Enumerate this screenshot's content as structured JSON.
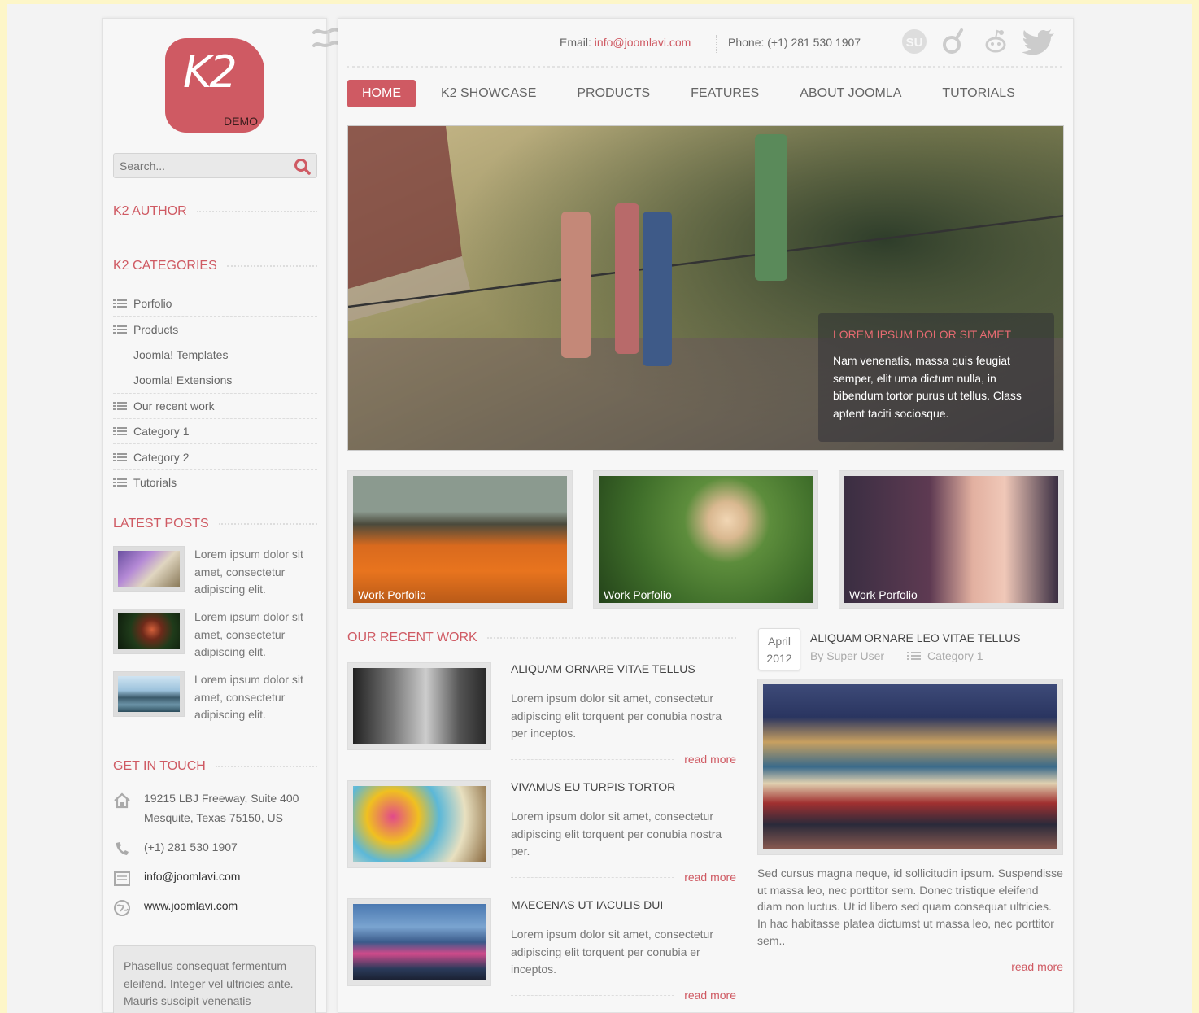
{
  "logo": {
    "mark": "K2",
    "sub": "DEMO"
  },
  "search": {
    "placeholder": "Search..."
  },
  "sidebar": {
    "author_title": "K2 AUTHOR",
    "categories_title": "K2 CATEGORIES",
    "categories": [
      {
        "label": "Porfolio"
      },
      {
        "label": "Products"
      },
      {
        "label": "Joomla! Templates"
      },
      {
        "label": "Joomla! Extensions"
      },
      {
        "label": "Our recent work"
      },
      {
        "label": "Category 1"
      },
      {
        "label": "Category 2"
      },
      {
        "label": "Tutorials"
      }
    ],
    "latest_title": "LATEST POSTS",
    "posts": [
      {
        "text": "Lorem ipsum dolor sit amet, consectetur adipiscing elit."
      },
      {
        "text": "Lorem ipsum dolor sit amet, consectetur adipiscing elit."
      },
      {
        "text": "Lorem ipsum dolor sit amet, consectetur adipiscing elit."
      }
    ],
    "touch_title": "GET IN TOUCH",
    "contact": {
      "address": "19215 LBJ Freeway, Suite 400 Mesquite, Texas 75150, US",
      "phone": "(+1) 281 530 1907",
      "email": "info@joomlavi.com",
      "web": "www.joomlavi.com"
    },
    "box_text": "Phasellus consequat fermentum eleifend. Integer vel ultricies ante. Mauris suscipit venenatis"
  },
  "topbar": {
    "email_label": "Email:",
    "email": "info@joomlavi.com",
    "phone": "Phone: (+1) 281 530 1907",
    "social": [
      "stumbleupon-icon",
      "delicious-icon",
      "reddit-icon",
      "twitter-icon"
    ]
  },
  "nav": [
    "HOME",
    "K2 SHOWCASE",
    "PRODUCTS",
    "FEATURES",
    "ABOUT JOOMLA",
    "TUTORIALS"
  ],
  "hero": {
    "title": "LOREM IPSUM DOLOR SIT AMET",
    "body": "Nam venenatis, massa quis feugiat semper, elit urna dictum nulla, in bibendum tortor purus ut tellus. Class aptent taciti sociosque."
  },
  "tiles": [
    {
      "label": "Work Porfolio"
    },
    {
      "label": "Work Porfolio"
    },
    {
      "label": "Work Porfolio"
    }
  ],
  "recent": {
    "title": "OUR RECENT WORK",
    "items": [
      {
        "title": "ALIQUAM ORNARE VITAE TELLUS",
        "body": "Lorem ipsum dolor sit amet, consectetur adipiscing elit torquent per conubia nostra per inceptos.",
        "more": "read more"
      },
      {
        "title": "VIVAMUS EU TURPIS TORTOR",
        "body": "Lorem ipsum dolor sit amet, consectetur adipiscing elit torquent per conubia nostra per.",
        "more": "read more"
      },
      {
        "title": "MAECENAS UT IACULIS DUI",
        "body": "Lorem ipsum dolor sit amet, consectetur adipiscing elit torquent per conubia er inceptos.",
        "more": "read more"
      }
    ]
  },
  "featured": {
    "month": "April",
    "year": "2012",
    "title": "ALIQUAM ORNARE LEO VITAE TELLUS",
    "author": "By Super User",
    "category": "Category 1",
    "body": "Sed cursus magna neque, id sollicitudin ipsum. Suspendisse ut massa leo, nec porttitor sem. Donec tristique eleifend diam non luctus. Ut id libero sed quam consequat ultricies. In hac habitasse platea dictumst ut massa leo, nec porttitor sem..",
    "more": "read more"
  },
  "colors": {
    "accent": "#cf5a63",
    "page_bg": "#fdf6c8"
  }
}
